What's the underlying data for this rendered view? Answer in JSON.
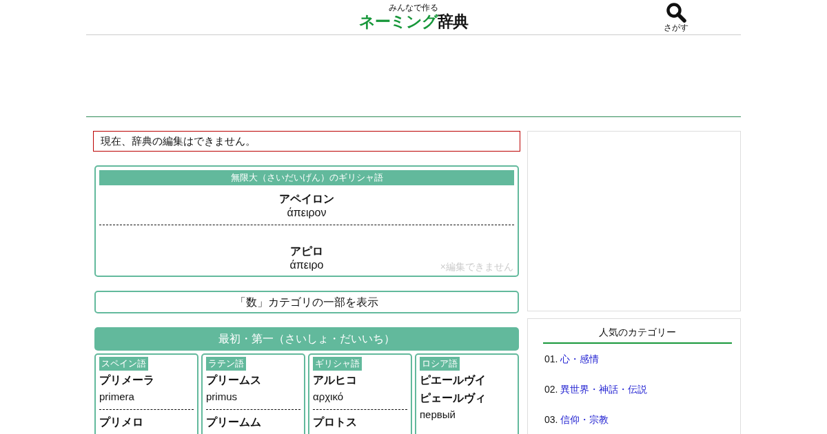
{
  "header": {
    "tagline": "みんなで作る",
    "logo_green": "ネーミング",
    "logo_black": "辞典",
    "search_label": "さがす"
  },
  "notice": "現在、辞典の編集はできません。",
  "featured": {
    "title": "無限大（さいだいげん）のギリシャ語",
    "entries": [
      {
        "reading": "アペイロン",
        "original": "άπειρον"
      },
      {
        "reading": "アピロ",
        "original": "άπειρο"
      }
    ],
    "note": "×編集できません"
  },
  "category_button": "「数」カテゴリの一部を表示",
  "category": {
    "title": "最初・第一（さいしょ・だいいち）",
    "languages": [
      {
        "language": "スペイン語",
        "entries": [
          {
            "readings": [
              "プリメーラ"
            ],
            "original": "primera"
          },
          {
            "readings": [
              "プリメロ"
            ]
          }
        ]
      },
      {
        "language": "ラテン語",
        "entries": [
          {
            "readings": [
              "プリームス"
            ],
            "original": "primus"
          },
          {
            "readings": [
              "プリームム"
            ]
          }
        ]
      },
      {
        "language": "ギリシャ語",
        "entries": [
          {
            "readings": [
              "アルヒコ"
            ],
            "original": "αρχικό"
          },
          {
            "readings": [
              "プロトス"
            ]
          }
        ]
      },
      {
        "language": "ロシア語",
        "entries": [
          {
            "readings": [
              "ピエールヴイ",
              "ピェールヴィ"
            ],
            "original": "первый"
          }
        ]
      }
    ]
  },
  "popular": {
    "title": "人気のカテゴリー",
    "items": [
      {
        "number": "01.",
        "label": "心・感情"
      },
      {
        "number": "02.",
        "label": "異世界・神話・伝説"
      },
      {
        "number": "03.",
        "label": "信仰・宗教"
      }
    ]
  }
}
